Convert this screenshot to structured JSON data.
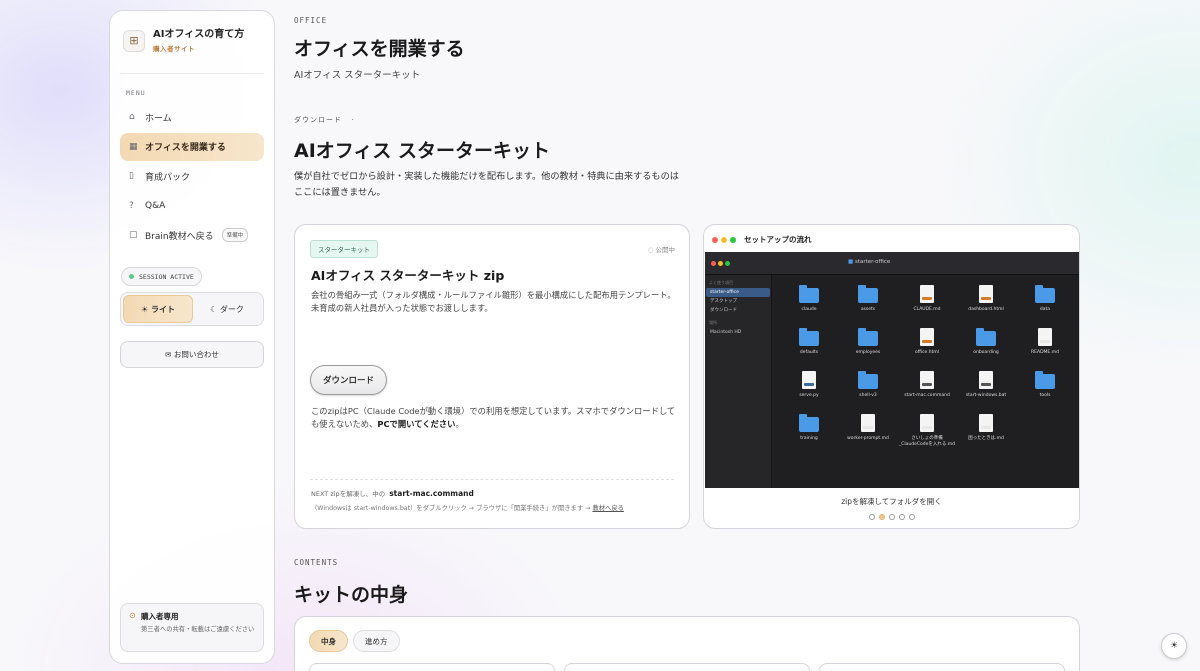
{
  "sidebar": {
    "brand_title": "AIオフィスの育て方",
    "brand_sub": "購入者サイト",
    "menu_label": "MENU",
    "nav": [
      {
        "label": "ホーム",
        "icon": "home-icon"
      },
      {
        "label": "オフィスを開業する",
        "icon": "building-icon"
      },
      {
        "label": "育成パック",
        "icon": "book-icon"
      },
      {
        "label": "Q&A",
        "icon": "question-icon"
      },
      {
        "label": "Brain教材へ戻る",
        "icon": "document-icon",
        "badge": "準備中"
      }
    ],
    "session": "SESSION ACTIVE",
    "theme_light": "ライト",
    "theme_dark": "ダーク",
    "contact": "お問い合わせ",
    "notice_title": "購入者専用",
    "notice_text": "第三者への共有・転載はご遠慮ください"
  },
  "header": {
    "eyebrow": "OFFICE",
    "title": "オフィスを開業する",
    "subtitle": "AIオフィス スターターキット"
  },
  "download": {
    "eyebrow": "ダウンロード",
    "title": "AIオフィス スターターキット",
    "lead": "僕が自社でゼロから設計・実装した機能だけを配布します。他の教材・特典に由来するものはここには置きません。"
  },
  "kit_card": {
    "tag": "スターターキット",
    "status": "公開中",
    "title": "AIオフィス スターターキット zip",
    "description": "会社の骨組み一式（フォルダ構成・ルールファイル雛形）を最小構成にした配布用テンプレート。未育成の新人社員が入った状態でお渡しします。",
    "download_label": "ダウンロード",
    "note_prefix": "このzipはPC（Claude Codeが動く環境）での利用を想定しています。スマホでダウンロードしても使えないため、",
    "note_strong": "PCで開いてください",
    "note_suffix": "。",
    "next_prefix": "NEXT zipを解凍し、中の",
    "next_code": "start-mac.command",
    "next_line2": "（Windowsは start-windows.bat）をダブルクリック → ブラウザに「開業手続き」が開きます →",
    "next_link": "教材へ戻る"
  },
  "setup_card": {
    "title": "セットアップの流れ",
    "caption": "zipを解凍してフォルダを開く",
    "finder_title": "starter-office",
    "sidebar_heads": [
      "よく使う項目",
      "場所"
    ],
    "sidebar_items": [
      "starter-office",
      "デスクトップ",
      "ダウンロード",
      "Macintosh HD"
    ],
    "files": [
      {
        "name": "claude",
        "kind": "folder"
      },
      {
        "name": "assets",
        "kind": "folder"
      },
      {
        "name": "CLAUDE.md",
        "kind": "doc-html"
      },
      {
        "name": "dashboard.html",
        "kind": "doc-html"
      },
      {
        "name": "data",
        "kind": "folder"
      },
      {
        "name": "defaults",
        "kind": "folder"
      },
      {
        "name": "employees",
        "kind": "folder"
      },
      {
        "name": "office.html",
        "kind": "doc-html"
      },
      {
        "name": "onboarding",
        "kind": "folder"
      },
      {
        "name": "README.md",
        "kind": "doc-md"
      },
      {
        "name": "serve.py",
        "kind": "doc-py"
      },
      {
        "name": "shell-v3",
        "kind": "folder"
      },
      {
        "name": "start-mac.command",
        "kind": "doc-cmd",
        "selected": true
      },
      {
        "name": "start-windows.bat",
        "kind": "doc-cmd"
      },
      {
        "name": "tools",
        "kind": "folder"
      },
      {
        "name": "training",
        "kind": "folder"
      },
      {
        "name": "worker-prompt.md",
        "kind": "doc-md"
      },
      {
        "name": "さいしょの準備_ClaudeCodeを入れる.md",
        "kind": "doc-md"
      },
      {
        "name": "困ったときは.md",
        "kind": "doc-md"
      }
    ],
    "slide_count": 5,
    "active_slide": 2
  },
  "contents": {
    "eyebrow": "CONTENTS",
    "title": "キットの中身",
    "tabs": [
      "中身",
      "進め方"
    ]
  },
  "colors": {
    "accent": "#f3d9b3",
    "tag_green": "#e6f6f1",
    "session_dot": "#5cc98d"
  }
}
